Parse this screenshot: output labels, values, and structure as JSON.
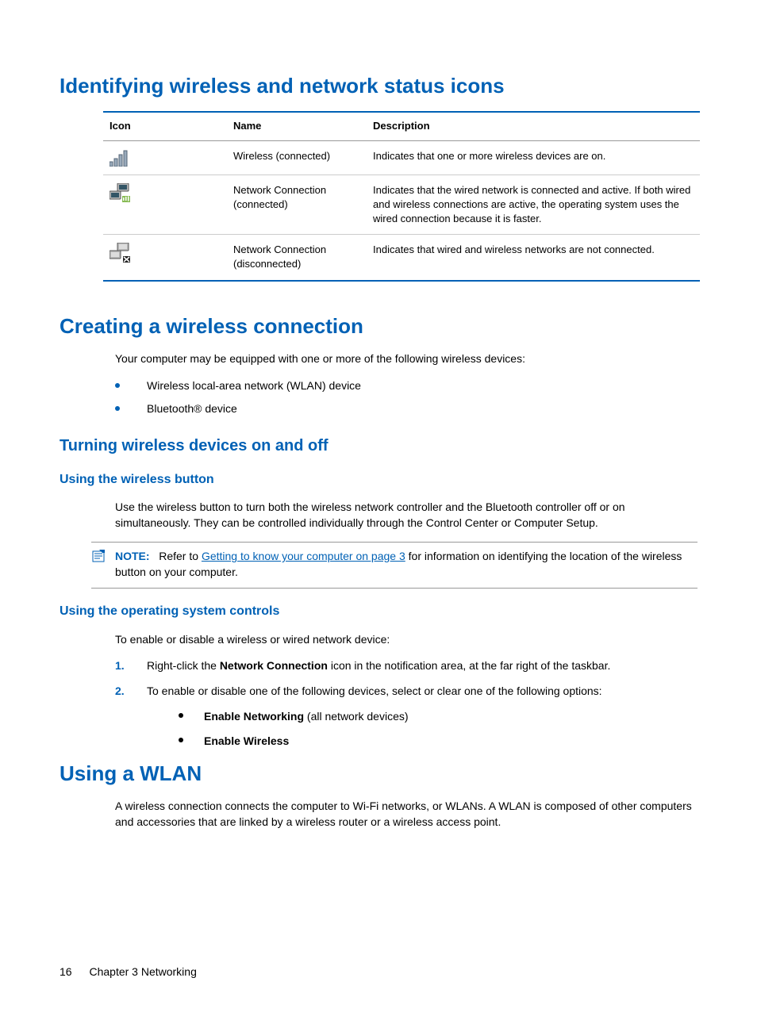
{
  "h1a": "Identifying wireless and network status icons",
  "table": {
    "headers": {
      "icon": "Icon",
      "name": "Name",
      "desc": "Description"
    },
    "rows": [
      {
        "name": "Wireless (connected)",
        "desc": "Indicates that one or more wireless devices are on."
      },
      {
        "name": "Network Connection (connected)",
        "desc": "Indicates that the wired network is connected and active. If both wired and wireless connections are active, the operating system uses the wired connection because it is faster."
      },
      {
        "name": "Network Connection (disconnected)",
        "desc": "Indicates that wired and wireless networks are not connected."
      }
    ]
  },
  "h1b": "Creating a wireless connection",
  "p1": "Your computer may be equipped with one or more of the following wireless devices:",
  "list1": [
    "Wireless local-area network (WLAN) device",
    "Bluetooth® device"
  ],
  "h2a": "Turning wireless devices on and off",
  "h3a": "Using the wireless button",
  "p2": "Use the wireless button to turn both the wireless network controller and the Bluetooth controller off or on simultaneously. They can be controlled individually through the Control Center or Computer Setup.",
  "note": {
    "label": "NOTE:",
    "pre": "Refer to ",
    "link": "Getting to know your computer on page 3",
    "post": " for information on identifying the location of the wireless button on your computer."
  },
  "h3b": "Using the operating system controls",
  "p3": "To enable or disable a wireless or wired network device:",
  "step1_a": "Right-click the ",
  "step1_bold": "Network Connection",
  "step1_b": " icon in the notification area, at the far right of the taskbar.",
  "step2": "To enable or disable one of the following devices, select or clear one of the following options:",
  "opt1_bold": "Enable Networking",
  "opt1_rest": " (all network devices)",
  "opt2_bold": "Enable Wireless",
  "h1c": "Using a WLAN",
  "p4": "A wireless connection connects the computer to Wi-Fi networks, or WLANs. A WLAN is composed of other computers and accessories that are linked by a wireless router or a wireless access point.",
  "footer": {
    "page": "16",
    "chapter": "Chapter 3   Networking"
  }
}
